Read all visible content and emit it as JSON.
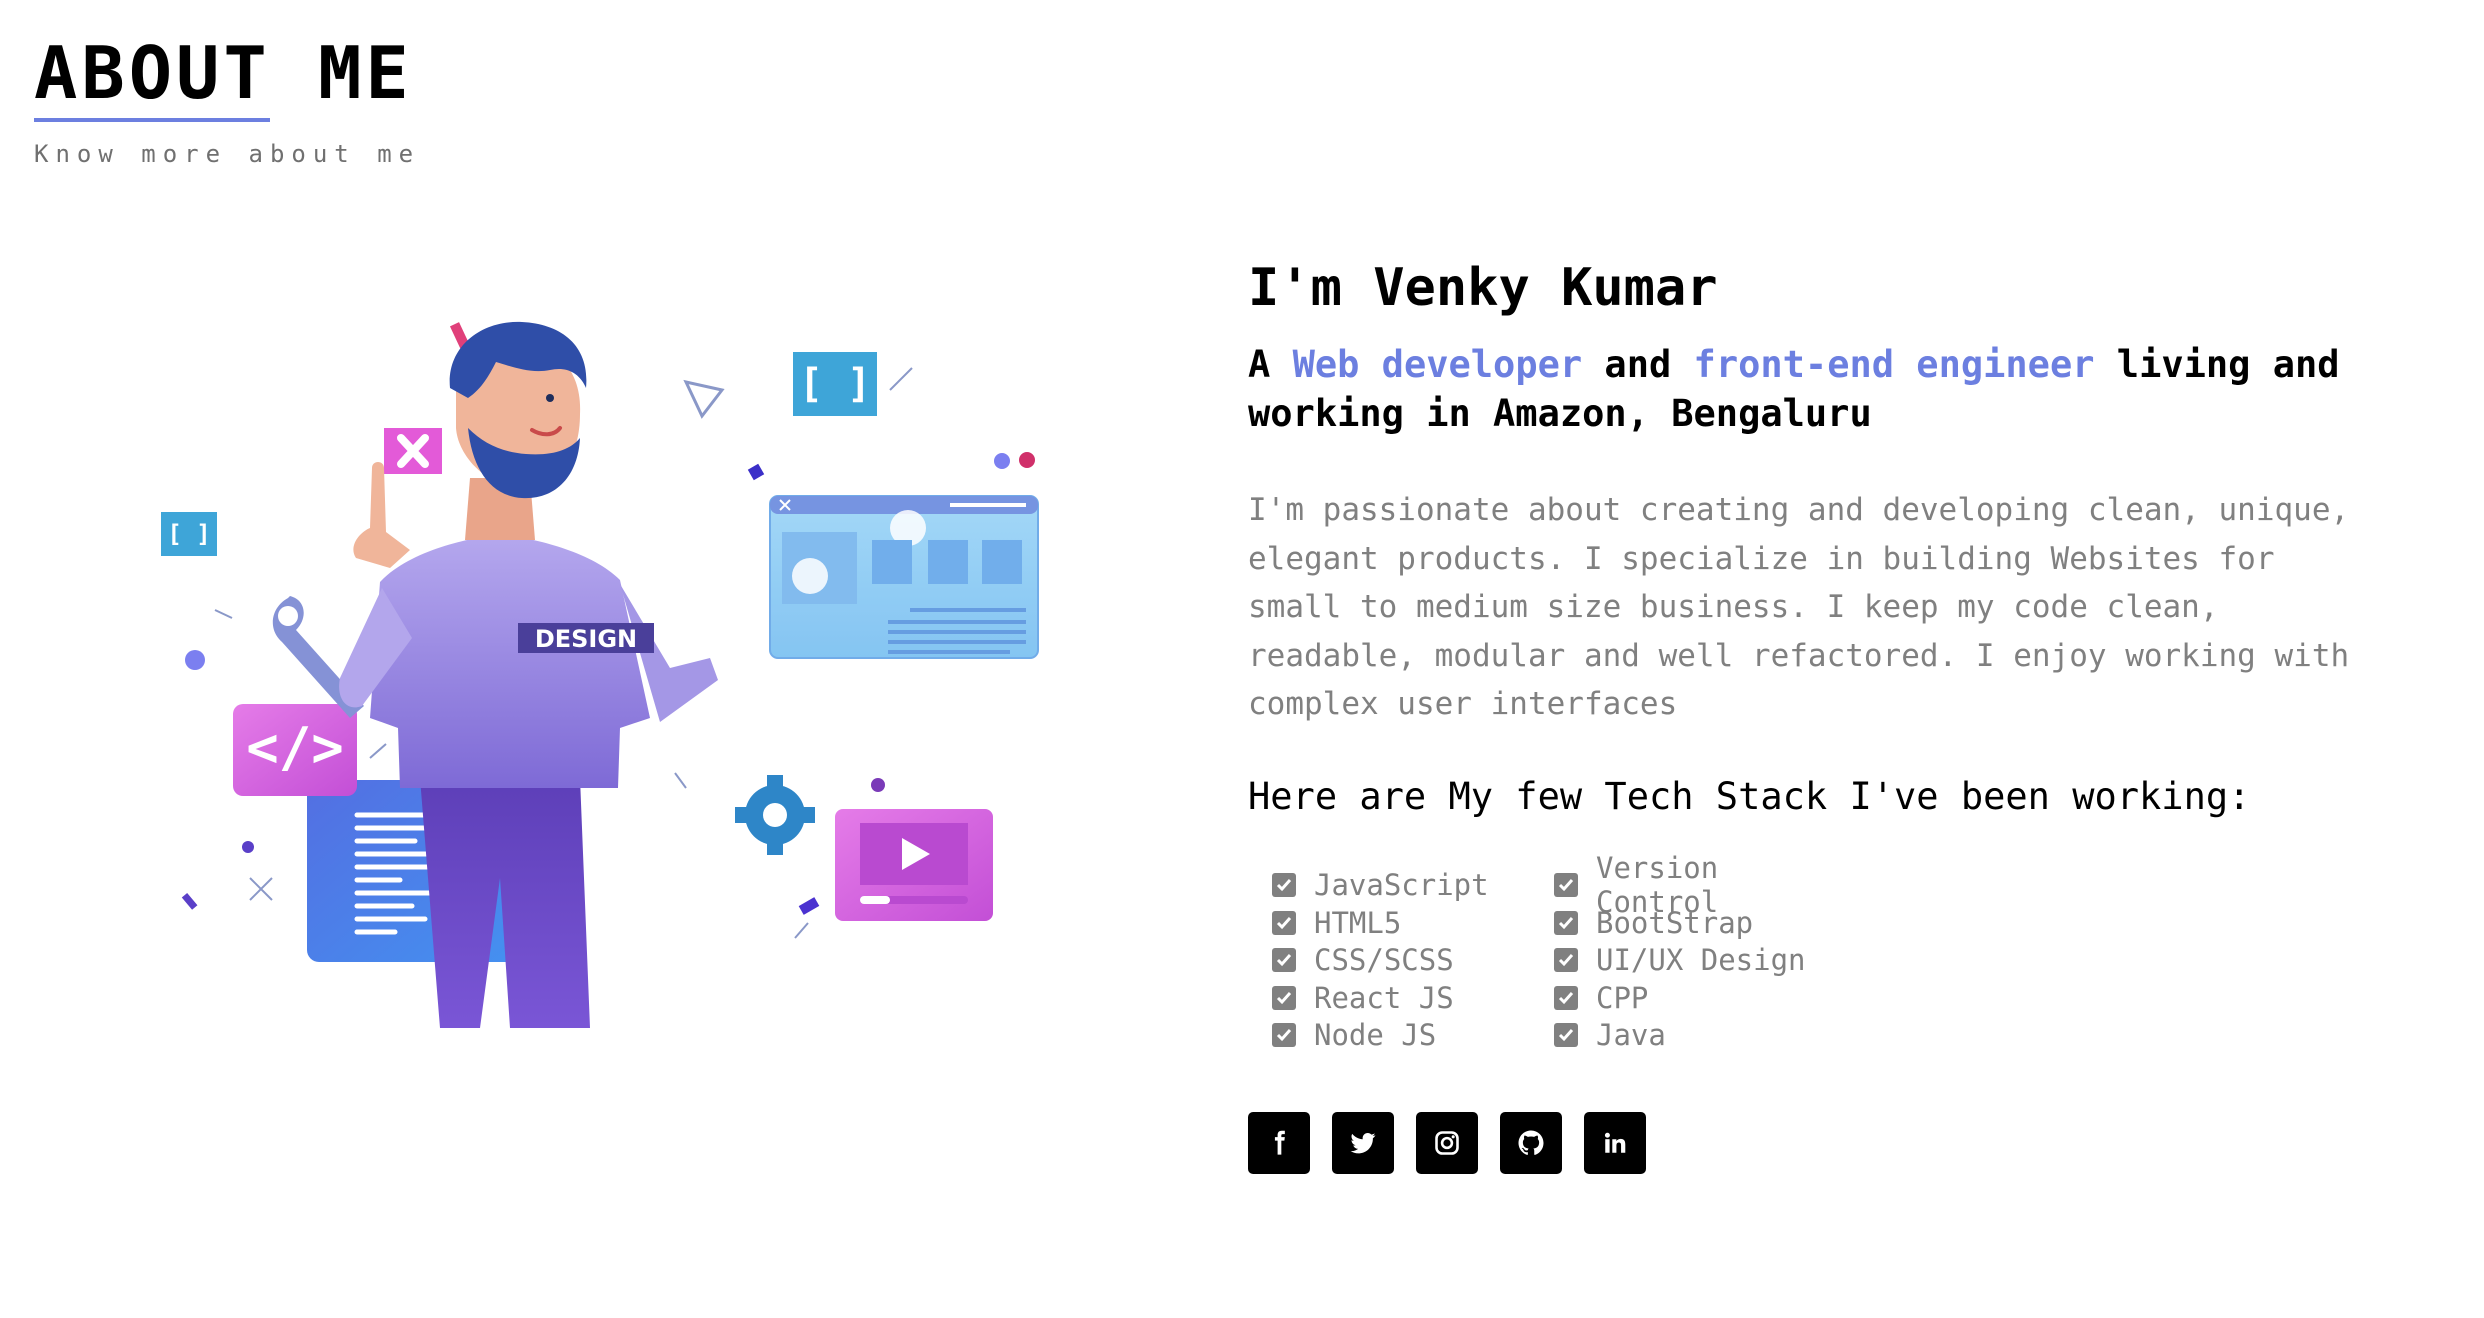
{
  "header": {
    "title": "ABOUT ME",
    "subtitle": "Know more about me"
  },
  "about": {
    "name": "I'm Venky Kumar",
    "tagline": {
      "part1": "A ",
      "accent1": "Web developer",
      "part2": " and ",
      "accent2": "front-end engineer",
      "part3": " living and working in Amazon, Bengaluru"
    },
    "description": "I'm passionate about creating and developing clean, unique, elegant products. I specialize in building Websites for small to medium size business. I keep my code clean, readable, modular and well refactored. I enjoy working with complex user interfaces",
    "stack_heading": "Here are My few Tech Stack I've been working:",
    "stack_left": [
      "JavaScript",
      "HTML5",
      "CSS/SCSS",
      "React JS",
      "Node JS"
    ],
    "stack_right": [
      "Version Control",
      "BootStrap",
      "UI/UX Design",
      "CPP",
      "Java"
    ]
  },
  "illustration": {
    "shirt_text": "DESIGN",
    "code_icon": "</>",
    "bracket_icon": "[ ]",
    "bracket_icon_small": "[ ]"
  },
  "social": {
    "icons": [
      "facebook-icon",
      "twitter-icon",
      "instagram-icon",
      "github-icon",
      "linkedin-icon"
    ]
  },
  "colors": {
    "accent": "#6c7fe0",
    "muted_text": "#808080",
    "social_bg": "#000000"
  }
}
